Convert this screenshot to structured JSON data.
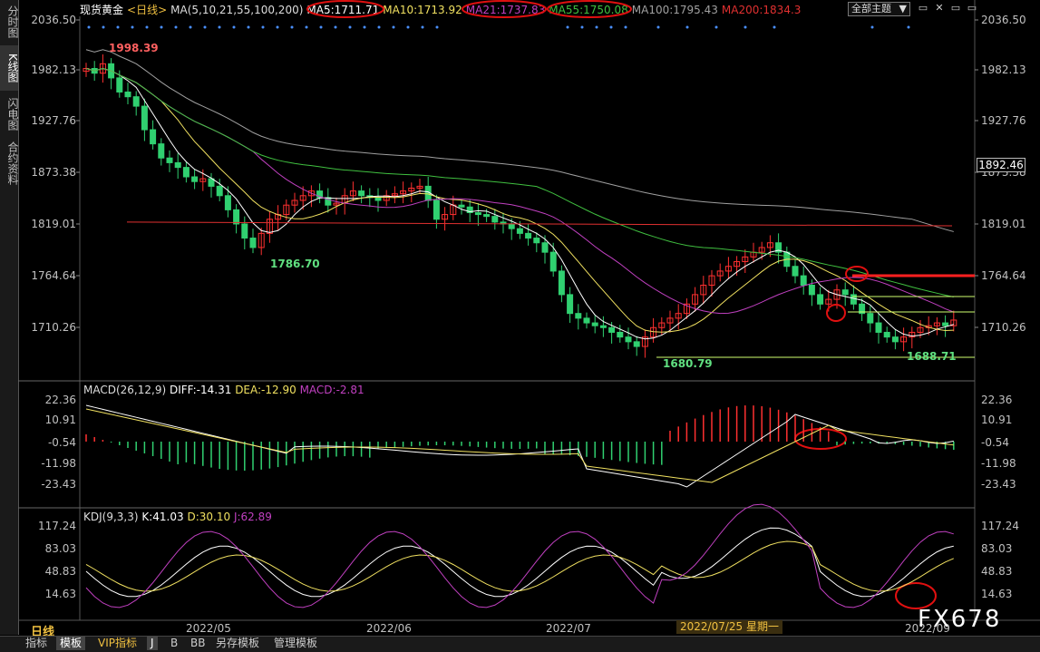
{
  "sidebar": {
    "items": [
      {
        "label": "分时图",
        "active": false
      },
      {
        "label": "K线图",
        "active": true
      },
      {
        "label": "闪电图",
        "active": false
      },
      {
        "label": "合约资料",
        "active": false
      }
    ]
  },
  "header": {
    "instrument": "现货黄金",
    "period": "<日线>",
    "ma_params": "MA(5,10,21,55,100,200)",
    "ma_values": [
      {
        "label": "MA5:1711.71",
        "color": "#ffffff",
        "circled": true
      },
      {
        "label": "MA10:1713.92",
        "color": "#f0e060",
        "circled": false
      },
      {
        "label": "MA21:1737.83",
        "color": "#c040c0",
        "circled": true
      },
      {
        "label": "MA55:1750.08",
        "color": "#40c040",
        "circled": true
      },
      {
        "label": "MA100:1795.43",
        "color": "#a0a0a0",
        "circled": false
      },
      {
        "label": "MA200:1834.3",
        "color": "#e03030",
        "circled": false
      }
    ],
    "theme_button": "全部主题",
    "window_buttons": [
      "▭",
      "✕",
      "▭",
      "▭"
    ]
  },
  "price_axis": {
    "left": [
      "2036.50",
      "1982.13",
      "1927.76",
      "1873.38",
      "1819.01",
      "1764.64",
      "1710.26"
    ],
    "right": [
      "2036.50",
      "1982.13",
      "1927.76",
      "1873.38",
      "1819.01",
      "1764.64",
      "1710.26"
    ],
    "current_price": "1892.46"
  },
  "annotations": {
    "high": "1998.39",
    "low1": "1786.70",
    "low2": "1680.79",
    "low3": "1688.71"
  },
  "macd": {
    "title": "MACD(26,12,9)",
    "diff": "DIFF:-14.31",
    "dea": "DEA:-12.90",
    "macd": "MACD:-2.81",
    "axis": [
      "22.36",
      "10.91",
      "-0.54",
      "-11.98",
      "-23.43"
    ]
  },
  "kdj": {
    "title": "KDJ(9,3,3)",
    "k": "K:41.03",
    "d": "D:30.10",
    "j": "J:62.89",
    "axis": [
      "117.24",
      "83.03",
      "48.83",
      "14.63"
    ]
  },
  "date_axis": {
    "period_label": "日线",
    "dates": [
      "2022/05",
      "2022/06",
      "2022/07",
      "2022/09"
    ],
    "selected": "2022/07/25 星期一"
  },
  "tabs": {
    "items": [
      {
        "label": "指标",
        "active": false
      },
      {
        "label": "模板",
        "active": true
      },
      {
        "label": "VIP指标",
        "active": false
      },
      {
        "label": "J",
        "active": true
      },
      {
        "label": "B",
        "active": false
      },
      {
        "label": "BB",
        "active": false
      },
      {
        "label": "另存模板",
        "active": false
      },
      {
        "label": "管理模板",
        "active": false
      }
    ]
  },
  "watermark": "FX678",
  "colors": {
    "up": "#ff3030",
    "down": "#30d070",
    "ma5": "#ffffff",
    "ma10": "#f0e060",
    "ma21": "#c040c0",
    "ma55": "#40c040",
    "ma100": "#a0a0a0",
    "ma200": "#e03030",
    "circle": "#e01010"
  }
}
